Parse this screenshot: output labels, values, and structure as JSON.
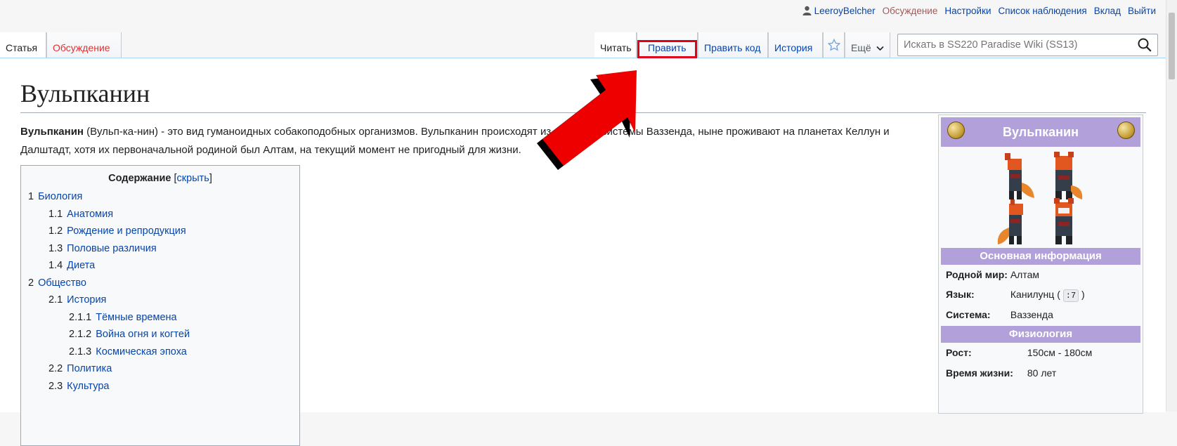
{
  "personal_tools": {
    "username": "LeeroyBelcher",
    "talk": "Обсуждение",
    "preferences": "Настройки",
    "watchlist": "Список наблюдения",
    "contributions": "Вклад",
    "logout": "Выйти"
  },
  "tabs": {
    "article": "Статья",
    "talk": "Обсуждение",
    "read": "Читать",
    "edit": "Править",
    "edit_source": "Править код",
    "history": "История",
    "more": "Ещё"
  },
  "search": {
    "placeholder": "Искать в SS220 Paradise Wiki (SS13)"
  },
  "page": {
    "title": "Вульпканин",
    "intro_bold": "Вульпканин",
    "intro_rest": " (Вульп-ка-нин) - это вид гуманоидных собакоподобных организмов. Вульпканин происходят из звёздной системы Ваззенда, ныне проживают на планетах Келлун и Далштадт, хотя их первоначальной родиной был Алтам, на текущий момент не пригодный для жизни."
  },
  "toc": {
    "title": "Содержание",
    "toggle": "скрыть",
    "items": [
      {
        "num": "1",
        "label": "Биология",
        "level": 1
      },
      {
        "num": "1.1",
        "label": "Анатомия",
        "level": 2
      },
      {
        "num": "1.2",
        "label": "Рождение и репродукция",
        "level": 2
      },
      {
        "num": "1.3",
        "label": "Половые различия",
        "level": 2
      },
      {
        "num": "1.4",
        "label": "Диета",
        "level": 2
      },
      {
        "num": "2",
        "label": "Общество",
        "level": 1
      },
      {
        "num": "2.1",
        "label": "История",
        "level": 2
      },
      {
        "num": "2.1.1",
        "label": "Тёмные времена",
        "level": 3
      },
      {
        "num": "2.1.2",
        "label": "Война огня и когтей",
        "level": 3
      },
      {
        "num": "2.1.3",
        "label": "Космическая эпоха",
        "level": 3
      },
      {
        "num": "2.2",
        "label": "Политика",
        "level": 2
      },
      {
        "num": "2.3",
        "label": "Культура",
        "level": 2
      }
    ]
  },
  "infobox": {
    "title": "Вульпканин",
    "section_basic": "Основная информация",
    "homeworld_label": "Родной мир:",
    "homeworld_value": "Алтам",
    "language_label": "Язык:",
    "language_value": "Канилунц (",
    "language_key": ":7",
    "language_close": ")",
    "system_label": "Система:",
    "system_value": "Ваззенда",
    "section_phys": "Физиология",
    "height_label": "Рост:",
    "height_value": "150см - 180см",
    "lifespan_label": "Время жизни:",
    "lifespan_value": "80 лет"
  },
  "icons": [
    "user-icon",
    "star-icon",
    "chevron-down-icon",
    "search-icon",
    "coin-icon",
    "arrow-annotation"
  ],
  "colors": {
    "link": "#0645ad",
    "red_link": "#d33",
    "infobox_header": "#b1a0d9",
    "highlight": "#e00018"
  }
}
